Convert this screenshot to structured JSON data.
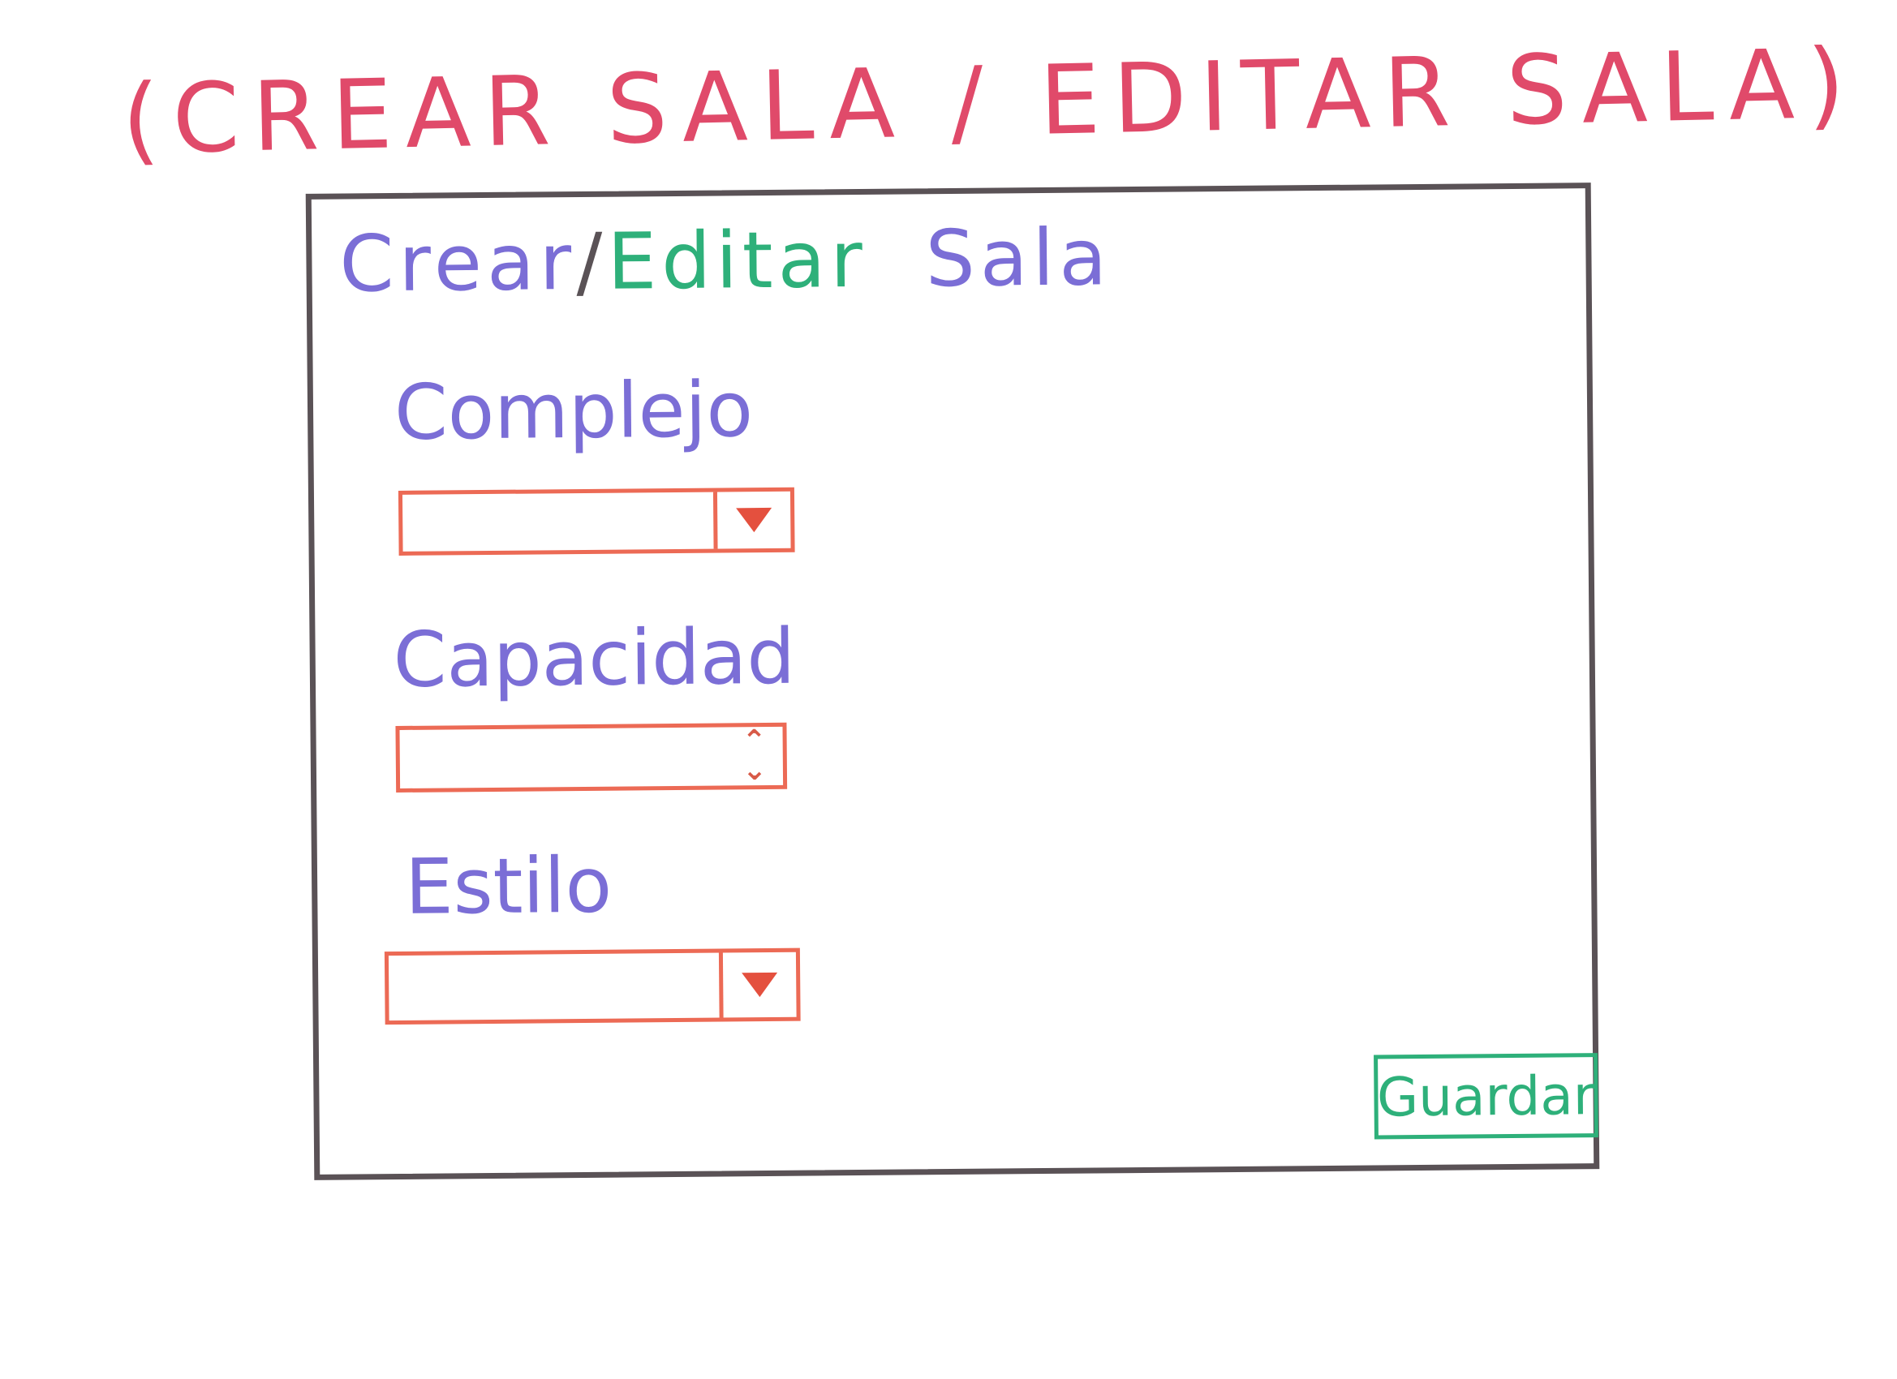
{
  "sketch_title": "(CREAR SALA / EDITAR SALA)",
  "window": {
    "title": {
      "crear": "Crear",
      "slash": "/",
      "editar": "Editar",
      "sala": "Sala"
    }
  },
  "form": {
    "complejo": {
      "label": "Complejo",
      "value": ""
    },
    "capacidad": {
      "label": "Capacidad",
      "value": ""
    },
    "estilo": {
      "label": "Estilo",
      "value": ""
    }
  },
  "actions": {
    "save_label": "Guardar"
  },
  "icons": {
    "dropdown": "chevron-down-icon",
    "stepper": "stepper-icon"
  },
  "colors": {
    "title_pink": "#e04a6a",
    "frame": "#5a5256",
    "label_purple": "#7b6ed6",
    "control_orange": "#ec6a55",
    "accent_green": "#2eb07a"
  }
}
